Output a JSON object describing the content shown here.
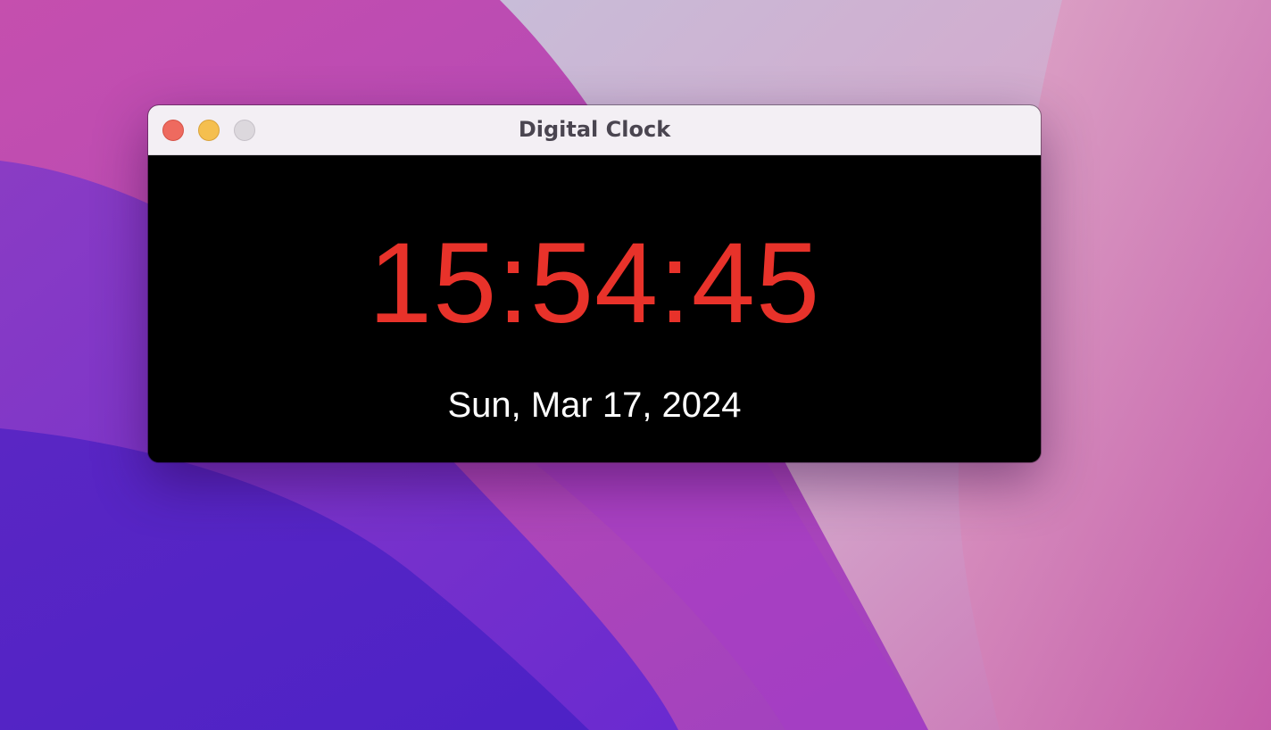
{
  "window": {
    "title": "Digital Clock",
    "controls": {
      "close_icon": "close-icon",
      "minimize_icon": "minimize-icon",
      "zoom_icon": "zoom-icon"
    }
  },
  "clock": {
    "time": "15:54:45",
    "date": "Sun, Mar 17, 2024"
  },
  "colors": {
    "time_text": "#e8322a",
    "date_text": "#ffffff",
    "clock_background": "#000000",
    "titlebar": "#f3eff4",
    "close_button": "#ee6a5f",
    "minimize_button": "#f5bf4f",
    "zoom_button_disabled": "#dcd8dd"
  }
}
